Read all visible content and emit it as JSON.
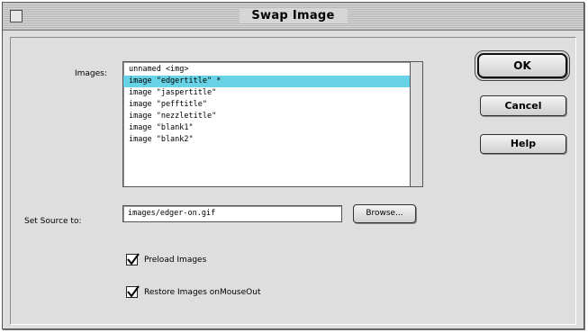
{
  "window": {
    "title": "Swap Image"
  },
  "images": {
    "label": "Images:",
    "items": [
      "unnamed <img>",
      "image \"edgertitle\" *",
      "image \"jaspertitle\"",
      "image \"pefftitle\"",
      "image \"nezzletitle\"",
      "image \"blank1\"",
      "image \"blank2\""
    ],
    "selected_index": 1
  },
  "source": {
    "label": "Set Source to:",
    "value": "images/edger-on.gif",
    "browse_label": "Browse..."
  },
  "buttons": {
    "ok": "OK",
    "cancel": "Cancel",
    "help": "Help"
  },
  "options": {
    "preload": {
      "label": "Preload Images",
      "checked": true
    },
    "restore": {
      "label": "Restore Images onMouseOut",
      "checked": true
    }
  },
  "colors": {
    "selection": "#68d3e6",
    "dialog_bg": "#dedede"
  }
}
